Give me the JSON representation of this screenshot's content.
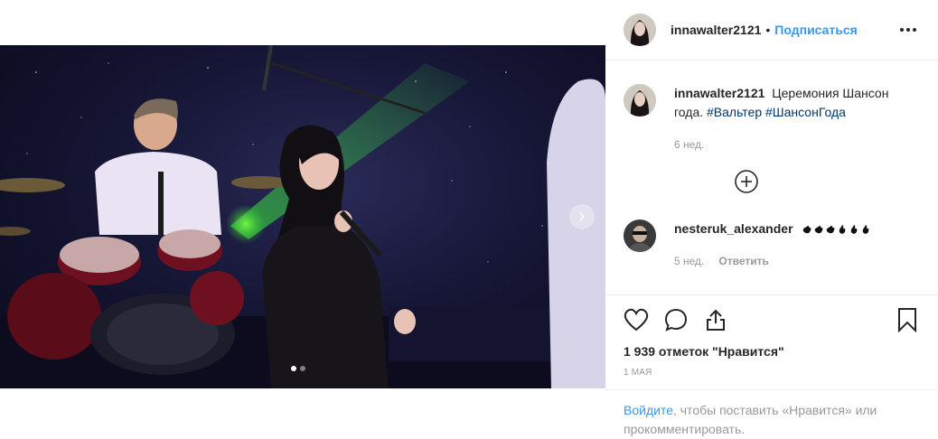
{
  "post": {
    "author": "innawalter2121",
    "separator": "•",
    "follow_label": "Подписаться"
  },
  "caption": {
    "author": "innawalter2121",
    "text": "Церемония Шансон года.",
    "hashtags": [
      "#Вальтер",
      "#ШансонГода"
    ],
    "age": "6 нед."
  },
  "comments": [
    {
      "author": "nesteruk_alexander",
      "emoji_count": 6,
      "age": "5 нед.",
      "reply_label": "Ответить"
    }
  ],
  "likes_text": "1 939 отметок \"Нравится\"",
  "post_date": "1 мая",
  "login_prompt": {
    "link": "Войдите",
    "text": ", чтобы поставить «Нравится» или прокомментировать."
  },
  "carousel": {
    "slides": 2,
    "active": 0
  },
  "colors": {
    "accent": "#3897f0",
    "hashtag": "#003569",
    "muted": "#999999",
    "text": "#262626",
    "border": "#efefef"
  },
  "icons": [
    "more-options-icon",
    "load-more-plus-icon",
    "heart-icon",
    "comment-icon",
    "share-icon",
    "bookmark-icon",
    "carousel-next-icon",
    "clap-emoji-icon"
  ]
}
